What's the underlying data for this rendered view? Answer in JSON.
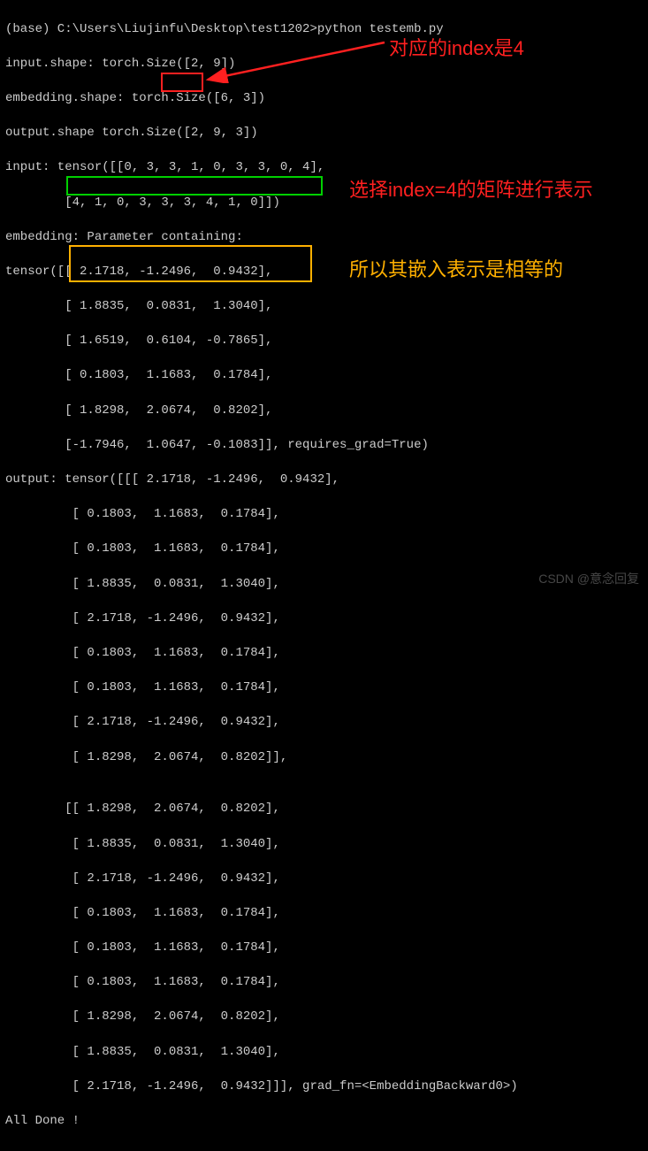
{
  "prompt": {
    "env": "(base)",
    "path": "C:\\Users\\Liujinfu\\Desktop\\test1202",
    "command": "python testemb.py"
  },
  "lines": {
    "l0": "(base) C:\\Users\\Liujinfu\\Desktop\\test1202>python testemb.py",
    "l1": "input.shape: torch.Size([2, 9])",
    "l2": "embedding.shape: torch.Size([6, 3])",
    "l3": "output.shape torch.Size([2, 9, 3])",
    "l4": "input: tensor([[0, 3, 3, 1, 0, 3, 3, 0, 4],",
    "l5": "        [4, 1, 0, 3, 3, 3, 4, 1, 0]])",
    "l6": "embedding: Parameter containing:",
    "l7": "tensor([[ 2.1718, -1.2496,  0.9432],",
    "l8": "        [ 1.8835,  0.0831,  1.3040],",
    "l9": "        [ 1.6519,  0.6104, -0.7865],",
    "l10": "        [ 0.1803,  1.1683,  0.1784],",
    "l11": "        [ 1.8298,  2.0674,  0.8202],",
    "l12": "        [-1.7946,  1.0647, -0.1083]], requires_grad=True)",
    "l13": "output: tensor([[[ 2.1718, -1.2496,  0.9432],",
    "l14": "         [ 0.1803,  1.1683,  0.1784],",
    "l15": "         [ 0.1803,  1.1683,  0.1784],",
    "l16": "         [ 1.8835,  0.0831,  1.3040],",
    "l17": "         [ 2.1718, -1.2496,  0.9432],",
    "l18": "         [ 0.1803,  1.1683,  0.1784],",
    "l19": "         [ 0.1803,  1.1683,  0.1784],",
    "l20": "         [ 2.1718, -1.2496,  0.9432],",
    "l21": "         [ 1.8298,  2.0674,  0.8202]],",
    "l22": "",
    "l23": "        [[ 1.8298,  2.0674,  0.8202],",
    "l24": "         [ 1.8835,  0.0831,  1.3040],",
    "l25": "         [ 2.1718, -1.2496,  0.9432],",
    "l26": "         [ 0.1803,  1.1683,  0.1784],",
    "l27": "         [ 0.1803,  1.1683,  0.1784],",
    "l28": "         [ 0.1803,  1.1683,  0.1784],",
    "l29": "         [ 1.8298,  2.0674,  0.8202],",
    "l30": "         [ 1.8835,  0.0831,  1.3040],",
    "l31": "         [ 2.1718, -1.2496,  0.9432]]], grad_fn=<EmbeddingBackward0>)",
    "l32": "All Done !"
  },
  "annotations": {
    "a1": "对应的index是4",
    "a2": "选择index=4的矩阵进行表示",
    "a3": "所以其嵌入表示是相等的"
  },
  "watermark": "CSDN @意念回复"
}
